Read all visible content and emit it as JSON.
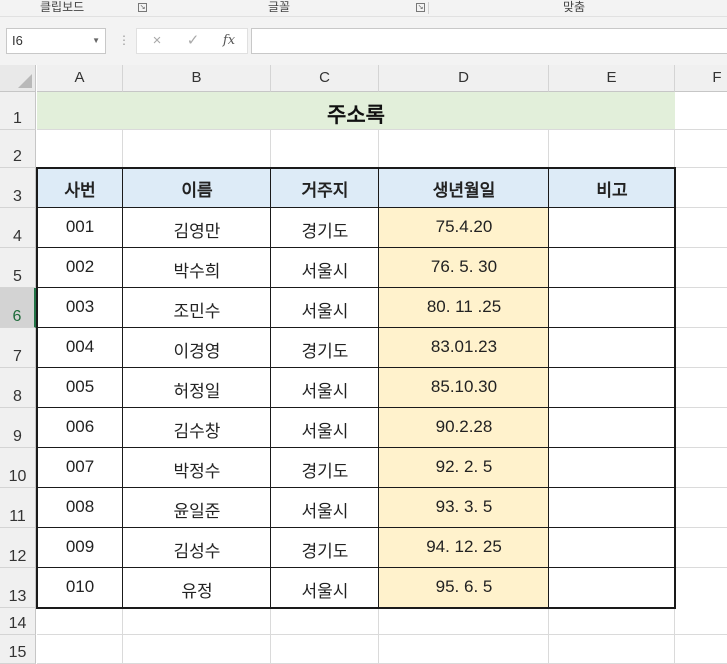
{
  "ribbon": {
    "groups": [
      "클립보드",
      "글꼴",
      "맞춤"
    ]
  },
  "formula_bar": {
    "name_box": "I6",
    "formula": "",
    "cancel_icon": "×",
    "enter_icon": "✓",
    "fx_label": "fx"
  },
  "sheet": {
    "columns": [
      "A",
      "B",
      "C",
      "D",
      "E",
      "F"
    ],
    "rows": [
      "1",
      "2",
      "3",
      "4",
      "5",
      "6",
      "7",
      "8",
      "9",
      "10",
      "11",
      "12",
      "13",
      "14",
      "15"
    ],
    "selected_row": "6",
    "title": "주소록",
    "headers": [
      "사번",
      "이름",
      "거주지",
      "생년월일",
      "비고"
    ],
    "records": [
      [
        "001",
        "김영만",
        "경기도",
        "75.4.20",
        ""
      ],
      [
        "002",
        "박수희",
        "서울시",
        "76. 5. 30",
        ""
      ],
      [
        "003",
        "조민수",
        "서울시",
        "80. 11 .25",
        ""
      ],
      [
        "004",
        "이경영",
        "경기도",
        "83.01.23",
        ""
      ],
      [
        "005",
        "허정일",
        "서울시",
        "85.10.30",
        ""
      ],
      [
        "006",
        "김수창",
        "서울시",
        "90.2.28",
        ""
      ],
      [
        "007",
        "박정수",
        "경기도",
        "92. 2. 5",
        ""
      ],
      [
        "008",
        "윤일준",
        "서울시",
        "93.  3. 5",
        ""
      ],
      [
        "009",
        "김성수",
        "경기도",
        "94. 12. 25",
        ""
      ],
      [
        "010",
        "유정",
        "서울시",
        "95. 6. 5",
        ""
      ]
    ]
  },
  "colors": {
    "title_fill": "#e2efda",
    "header_fill": "#ddebf7",
    "dob_fill": "#fff2cc",
    "selection_accent": "#217346"
  }
}
